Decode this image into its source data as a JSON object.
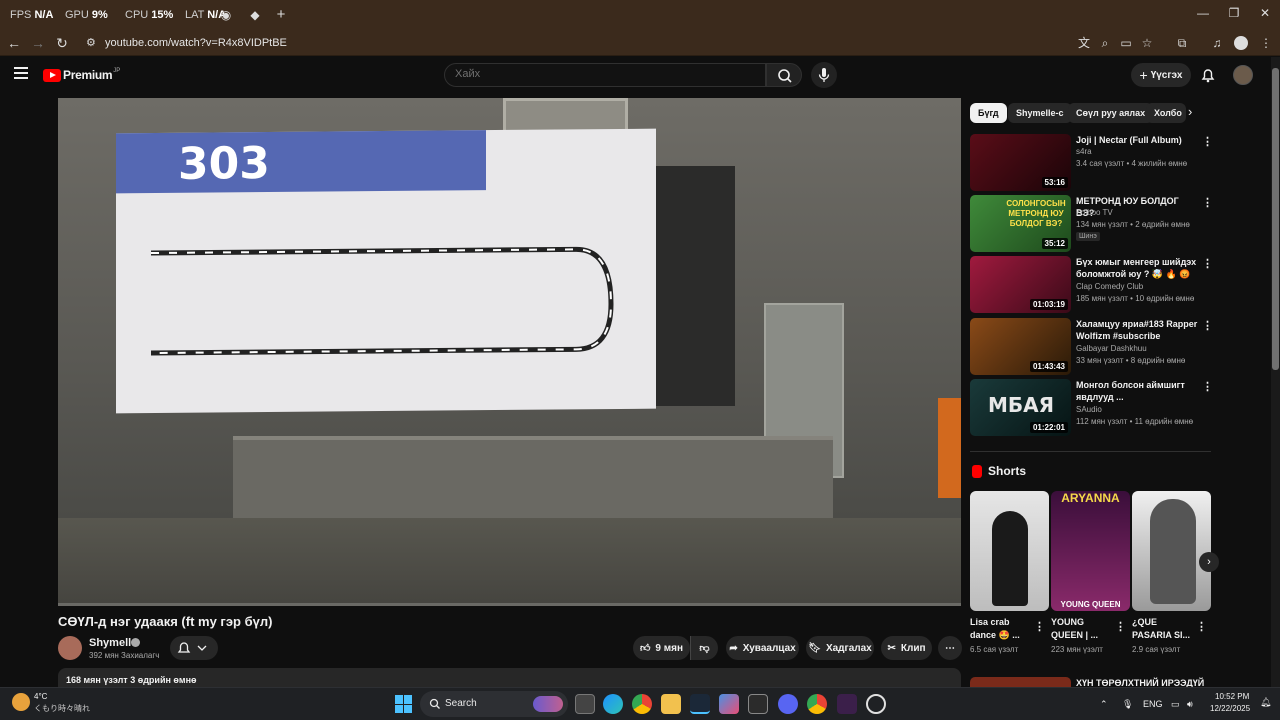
{
  "hud": {
    "fps_label": "FPS",
    "fps_value": "N/A",
    "gpu_label": "GPU",
    "gpu_value": "9%",
    "cpu_label": "CPU",
    "cpu_value": "15%",
    "lat_label": "LAT",
    "lat_value": "N/A"
  },
  "browser": {
    "url": "youtube.com/watch?v=R4x8VIDPtBE",
    "new_tab": "+",
    "minimize": "—",
    "maximize": "❐",
    "close": "✕"
  },
  "youtube": {
    "logo_text": "Premium",
    "logo_region": "JP",
    "search_placeholder": "Хайх",
    "create_label": "Үүсгэх"
  },
  "video": {
    "title": "СӨҮЛ-д нэг удаакя (ft my гэр бүл)",
    "poster_route": "303",
    "channel": "Shymelle",
    "subscribers": "392 мян Захиалагч",
    "likes": "9 мян",
    "share_label": "Хуваалцах",
    "save_label": "Хадгалах",
    "clip_label": "Клип",
    "stats": "168 мян үзэлт  3 өдрийн өмнө"
  },
  "chips": [
    "Бүгд",
    "Shymelle-с",
    "Сөүл руу аялах",
    "Холбо"
  ],
  "recommendations": [
    {
      "title": "Joji | Nectar (Full Album)",
      "channel": "s4ra",
      "meta": "3.4 сая үзэлт • 4 жилийн өмнө",
      "duration": "53:16",
      "color": "#3a0a12"
    },
    {
      "title": "МЕТРОНД ЮУ БОЛДОГ ВЭ?",
      "channel": "Zolboo TV",
      "meta": "134 мян үзэлт • 2 өдрийн өмнө",
      "duration": "35:12",
      "badge": "Шинэ",
      "color": "#2f6e2f",
      "thumb_text": "СОЛОНГОСЫН МЕТРОНД ЮУ БОЛДОГ ВЭ?"
    },
    {
      "title": "Бүх юмыг менгеер шийдэх боломжтой юу ? 🤯 🔥 😡 З...",
      "channel": "Clap Comedy Club",
      "meta": "185 мян үзэлт • 10 өдрийн өмнө",
      "duration": "01:03:19",
      "color": "#7a1030"
    },
    {
      "title": "Халамцуу яриа#183 Rapper Wolfizm #subscribe",
      "channel": "Galbayar Dashkhuu",
      "meta": "33 мян үзэлт • 8 өдрийн өмнө",
      "duration": "01:43:43",
      "color": "#6a3a10"
    },
    {
      "title": "Монгол болсон аймшигт явдлууд ...",
      "channel": "SAudio",
      "meta": "112 мян үзэлт • 11 өдрийн өмнө",
      "duration": "01:22:01",
      "color": "#0f2a2a",
      "thumb_text": "МБАЯ"
    }
  ],
  "shorts": {
    "header": "Shorts",
    "items": [
      {
        "title": "Lisa crab dance 🤩 ...",
        "views": "6.5 сая үзэлт",
        "color": "#d8d8d8"
      },
      {
        "title": "YOUNG QUEEN | ...",
        "views": "223 мян үзэлт",
        "color": "#5a1a5a",
        "top_text": "ARYANNA",
        "bottom_text": "YOUNG QUEEN"
      },
      {
        "title": "¿QUE PASARIA SI...",
        "views": "2.9 сая үзэлт",
        "color": "#e0e0e0"
      }
    ]
  },
  "next_rec_title": "ХҮН ТӨРӨЛХТНИЙ ИРЭЭДҮЙ",
  "taskbar": {
    "weather_temp": "4°C",
    "weather_desc": "くもり時々晴れ",
    "search_label": "Search",
    "lang": "ENG",
    "time": "10:52 PM",
    "date": "12/22/2025"
  }
}
